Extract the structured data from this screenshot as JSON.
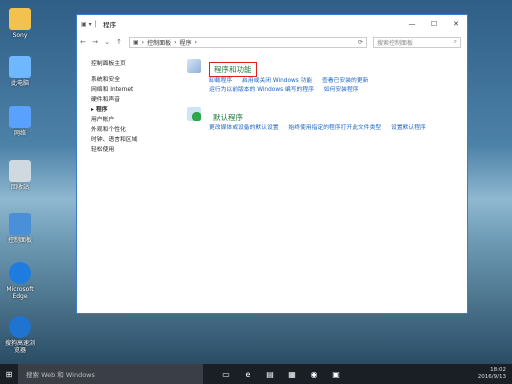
{
  "desktop": {
    "icons": [
      {
        "label": "Sony",
        "icon": "user-folder-icon",
        "color": "#f2c14e"
      },
      {
        "label": "此电脑",
        "icon": "computer-icon",
        "color": "#6fb7ff"
      },
      {
        "label": "网络",
        "icon": "network-icon",
        "color": "#5aa0ff"
      },
      {
        "label": "回收站",
        "icon": "recycle-bin-icon",
        "color": "#d0d8e0"
      },
      {
        "label": "控制面板",
        "icon": "control-panel-icon",
        "color": "#4a90d9"
      },
      {
        "label": "Microsoft Edge",
        "icon": "edge-icon",
        "color": "#1e7be0"
      },
      {
        "label": "搜狗高速浏览器",
        "icon": "sogou-icon",
        "color": "#1e74d0"
      }
    ]
  },
  "window": {
    "title": "程序",
    "controls": {
      "minimize": "—",
      "maximize": "☐",
      "close": "✕"
    },
    "address": {
      "segments": [
        "控制面板",
        "程序"
      ],
      "separator": "›"
    },
    "search_placeholder": "搜索控制面板",
    "leftnav": {
      "home": "控制面板主页",
      "items": [
        "系统和安全",
        "网络和 Internet",
        "硬件和声音",
        "程序",
        "用户帐户",
        "外观和个性化",
        "时钟、语言和区域",
        "轻松使用"
      ],
      "current": "程序"
    },
    "sections": [
      {
        "title": "程序和功能",
        "icon": "programs-icon",
        "links_row1": [
          "卸载程序",
          "启用或关闭 Windows 功能",
          "查看已安装的更新"
        ],
        "links_row2": [
          "运行为以前版本的 Windows 编写的程序",
          "如何安装程序"
        ]
      },
      {
        "title": "默认程序",
        "icon": "default-programs-icon",
        "links_row1": [
          "更改媒体或设备的默认设置",
          "始终使用指定的程序打开此文件类型",
          "设置默认程序"
        ]
      }
    ]
  },
  "taskbar": {
    "search_text": "搜索 Web 和 Windows",
    "time": "18:02",
    "date": "2016/9/13"
  },
  "colors": {
    "accent": "#3a7bd5",
    "highlight": "#e02020",
    "link": "#1c64c6",
    "section_title": "#1f7a3a"
  }
}
